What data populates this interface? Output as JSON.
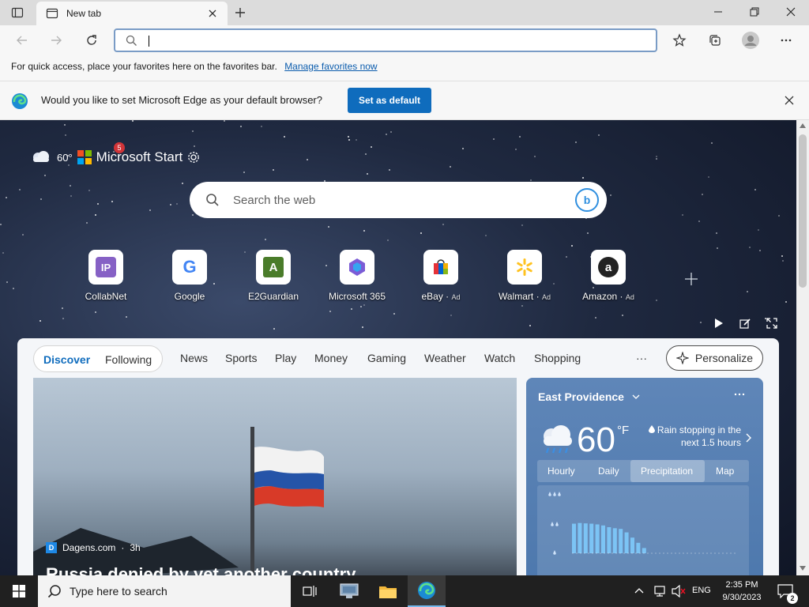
{
  "colors": {
    "accent": "#0f6cbd",
    "link": "#0b5cad",
    "taskbar": "#202020",
    "weather_bg": "#5b82b5"
  },
  "browser": {
    "tab_title": "New tab",
    "address_value": "",
    "favorites_bar": {
      "message": "For quick access, place your favorites here on the favorites bar.",
      "link": "Manage favorites now"
    },
    "default_prompt": {
      "message": "Would you like to set Microsoft Edge as your default browser?",
      "button": "Set as default"
    }
  },
  "newtab": {
    "weather_mini": "60°",
    "brand": "Microsoft Start",
    "notification_count": "5",
    "search_placeholder": "Search the web",
    "tiles": [
      {
        "label": "CollabNet",
        "icon_text": "IP",
        "ad": ""
      },
      {
        "label": "Google",
        "icon_text": "G",
        "ad": ""
      },
      {
        "label": "E2Guardian",
        "icon_text": "A",
        "ad": ""
      },
      {
        "label": "Microsoft 365",
        "icon_text": "",
        "ad": ""
      },
      {
        "label": "eBay",
        "icon_text": "",
        "ad": "Ad"
      },
      {
        "label": "Walmart",
        "icon_text": "",
        "ad": "Ad"
      },
      {
        "label": "Amazon",
        "icon_text": "a",
        "ad": "Ad"
      }
    ],
    "feed_tabs": {
      "discover": "Discover",
      "following": "Following",
      "items": [
        "News",
        "Sports",
        "Play",
        "Money",
        "Gaming",
        "Weather",
        "Watch",
        "Shopping"
      ],
      "more": "···",
      "personalize": "Personalize"
    },
    "article": {
      "source": "Dagens.com",
      "age": "3h",
      "source_logo": "D",
      "headline": "Russia denied by yet another country"
    },
    "weather": {
      "location": "East Providence",
      "temp": "60",
      "unit": "°F",
      "description": "Rain stopping in the next 1.5 hours",
      "tabs": [
        "Hourly",
        "Daily",
        "Precipitation",
        "Map"
      ],
      "active_tab": "Precipitation",
      "precip_levels": [
        0.85,
        0.87,
        0.86,
        0.85,
        0.83,
        0.8,
        0.75,
        0.72,
        0.7,
        0.6,
        0.45,
        0.3,
        0.15
      ]
    }
  },
  "taskbar": {
    "search_placeholder": "Type here to search",
    "language": "ENG",
    "time": "2:35 PM",
    "date": "9/30/2023",
    "notification_count": "2"
  }
}
